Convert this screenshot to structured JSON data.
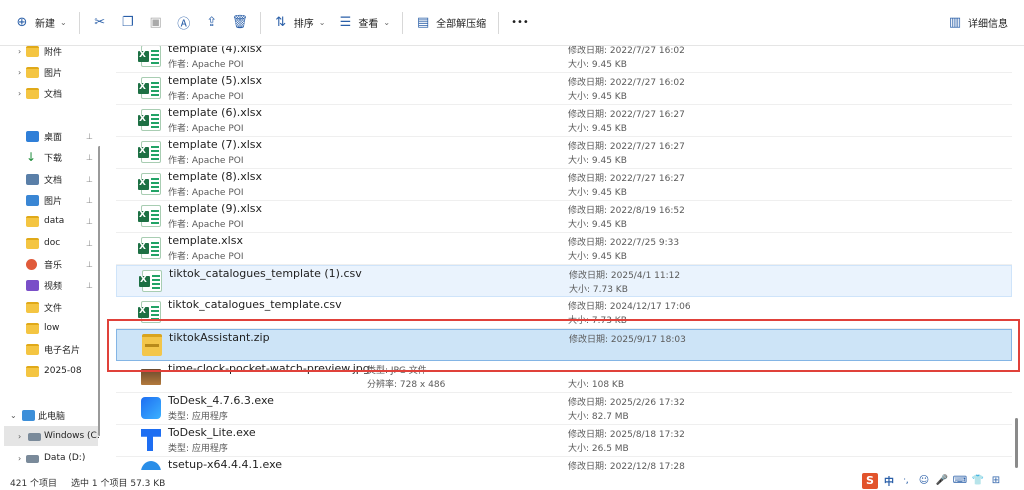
{
  "toolbar": {
    "new_label": "新建",
    "sort_label": "排序",
    "view_label": "查看",
    "extract_label": "全部解压缩",
    "more_label": "•••",
    "details_label": "详细信息"
  },
  "sidebar": {
    "items": [
      {
        "label": "附件",
        "chevron": "›"
      },
      {
        "label": "图片",
        "chevron": "›"
      },
      {
        "label": "文档",
        "chevron": "›"
      },
      {
        "label": "桌面",
        "pin": "📌"
      },
      {
        "label": "下载",
        "pin": "📌"
      },
      {
        "label": "文档",
        "pin": "📌"
      },
      {
        "label": "图片",
        "pin": "📌"
      },
      {
        "label": "data",
        "pin": "📌"
      },
      {
        "label": "doc",
        "pin": "📌"
      },
      {
        "label": "音乐",
        "pin": "📌"
      },
      {
        "label": "视频",
        "pin": "📌"
      },
      {
        "label": "文件"
      },
      {
        "label": "low"
      },
      {
        "label": "电子名片"
      },
      {
        "label": "2025-08"
      },
      {
        "label": "此电脑",
        "chevron": "⌄"
      },
      {
        "label": "Windows (C:)",
        "chevron": "›"
      },
      {
        "label": "Data (D:)",
        "chevron": "›"
      }
    ]
  },
  "files": [
    {
      "name": "template (4).xlsx",
      "sub": "作者: Apache POI",
      "m1": "修改日期: 2022/7/27 16:02",
      "m2": "大小: 9.45 KB"
    },
    {
      "name": "template (5).xlsx",
      "sub": "作者: Apache POI",
      "m1": "修改日期: 2022/7/27 16:02",
      "m2": "大小: 9.45 KB"
    },
    {
      "name": "template (6).xlsx",
      "sub": "作者: Apache POI",
      "m1": "修改日期: 2022/7/27 16:27",
      "m2": "大小: 9.45 KB"
    },
    {
      "name": "template (7).xlsx",
      "sub": "作者: Apache POI",
      "m1": "修改日期: 2022/7/27 16:27",
      "m2": "大小: 9.45 KB"
    },
    {
      "name": "template (8).xlsx",
      "sub": "作者: Apache POI",
      "m1": "修改日期: 2022/7/27 16:27",
      "m2": "大小: 9.45 KB"
    },
    {
      "name": "template (9).xlsx",
      "sub": "作者: Apache POI",
      "m1": "修改日期: 2022/8/19 16:52",
      "m2": "大小: 9.45 KB"
    },
    {
      "name": "template.xlsx",
      "sub": "作者: Apache POI",
      "m1": "修改日期: 2022/7/25 9:33",
      "m2": "大小: 9.45 KB"
    },
    {
      "name": "tiktok_catalogues_template (1).csv",
      "sub": "",
      "m1": "修改日期: 2025/4/1 11:12",
      "m2": "大小: 7.73 KB"
    },
    {
      "name": "tiktok_catalogues_template.csv",
      "sub": "",
      "m1": "修改日期: 2024/12/17 17:06",
      "m2": "大小: 7.73 KB"
    },
    {
      "name": "tiktokAssistant.zip",
      "sub": "",
      "m1": "修改日期: 2025/9/17 18:03",
      "m2": ""
    },
    {
      "name": "time-clock-pocket-watch-preview.jpg",
      "sub": "",
      "mid1": "类型: JPG 文件",
      "mid2": "分辨率: 728 x 486",
      "m1": "",
      "m2": "大小: 108 KB"
    },
    {
      "name": "ToDesk_4.7.6.3.exe",
      "sub": "类型: 应用程序",
      "m1": "修改日期: 2025/2/26 17:32",
      "m2": "大小: 82.7 MB"
    },
    {
      "name": "ToDesk_Lite.exe",
      "sub": "类型: 应用程序",
      "m1": "修改日期: 2025/8/18 17:32",
      "m2": "大小: 26.5 MB"
    },
    {
      "name": "tsetup-x64.4.4.1.exe",
      "sub": "",
      "m1": "修改日期: 2022/12/8 17:28",
      "m2": ""
    }
  ],
  "status": {
    "count": "421 个项目",
    "selection": "选中 1 个项目 57.3 KB"
  },
  "ime": {
    "logo": "S",
    "lang": "中"
  }
}
